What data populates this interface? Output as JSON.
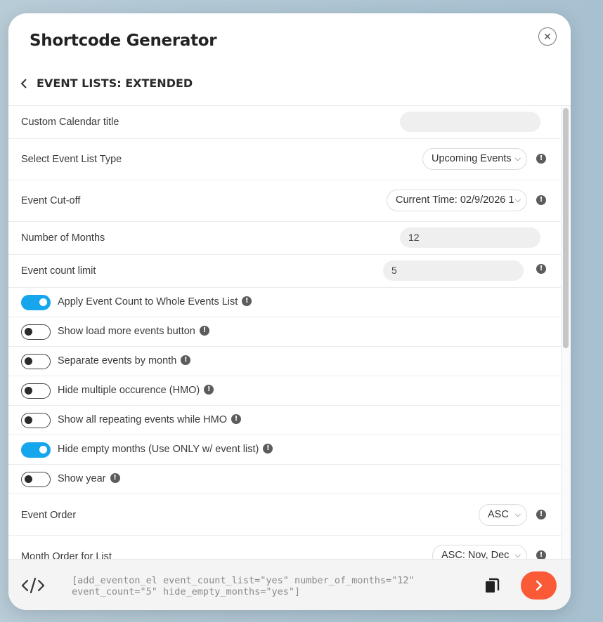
{
  "modal": {
    "title": "Shortcode Generator",
    "close_symbol": "✕",
    "section_title": "EVENT LISTS: EXTENDED"
  },
  "fields": {
    "calendar_title": {
      "label": "Custom Calendar title",
      "value": ""
    },
    "list_type": {
      "label": "Select Event List Type",
      "value": "Upcoming Events"
    },
    "cut_off": {
      "label": "Event Cut-off",
      "value": "Current Time: 02/9/2026 1"
    },
    "months": {
      "label": "Number of Months",
      "value": "12"
    },
    "count_limit": {
      "label": "Event count limit",
      "value": "5"
    },
    "event_order": {
      "label": "Event Order",
      "value": "ASC"
    },
    "month_order": {
      "label": "Month Order for List",
      "value": "ASC: Nov, Dec"
    }
  },
  "toggles": [
    {
      "label": "Apply Event Count to Whole Events List",
      "on": true
    },
    {
      "label": "Show load more events button",
      "on": false
    },
    {
      "label": "Separate events by month",
      "on": false
    },
    {
      "label": "Hide multiple occurence (HMO)",
      "on": false
    },
    {
      "label": "Show all repeating events while HMO",
      "on": false
    },
    {
      "label": "Hide empty months (Use ONLY w/ event list)",
      "on": true
    },
    {
      "label": "Show year",
      "on": false
    }
  ],
  "info_symbol": "!",
  "chevron_symbol": "❯",
  "footer": {
    "shortcode": "[add_eventon_el event_count_list=\"yes\" number_of_months=\"12\" event_count=\"5\" hide_empty_months=\"yes\"]"
  },
  "colors": {
    "accent_toggle": "#16a6ee",
    "go_button": "#fb5a37"
  }
}
